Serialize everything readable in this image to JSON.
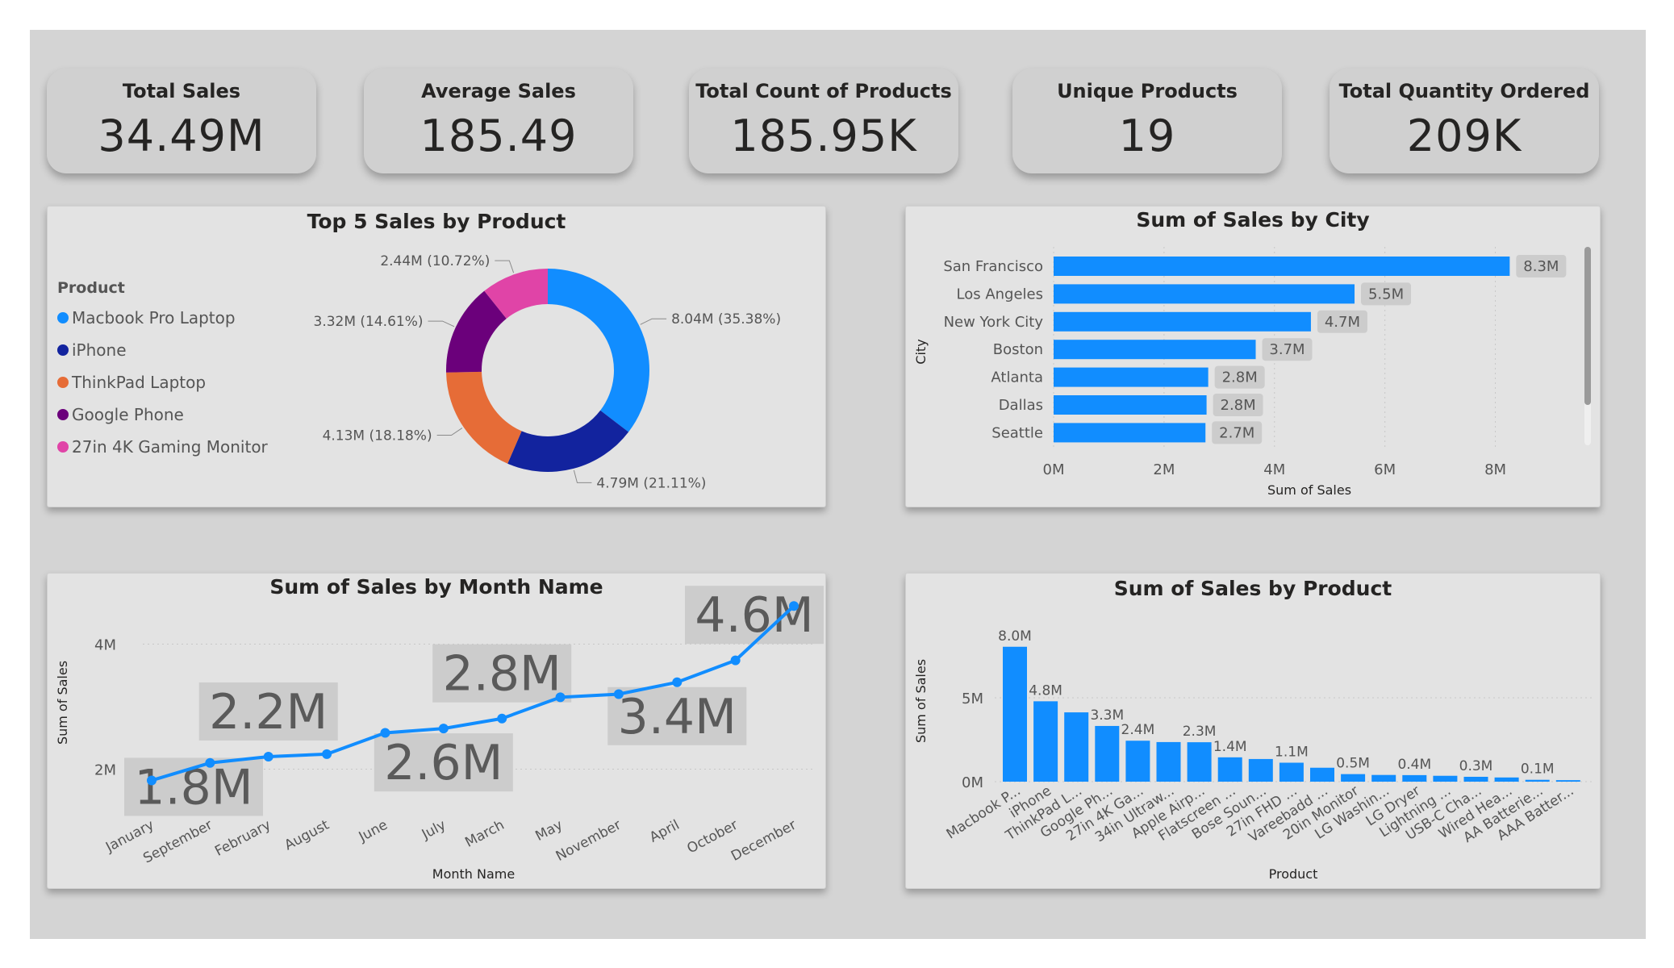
{
  "kpis": [
    {
      "title": "Total Sales",
      "value": "34.49M"
    },
    {
      "title": "Average Sales",
      "value": "185.49"
    },
    {
      "title": "Total Count of Products",
      "value": "185.95K"
    },
    {
      "title": "Unique Products",
      "value": "19"
    },
    {
      "title": "Total Quantity Ordered",
      "value": "209K"
    }
  ],
  "colors": {
    "bar": "#118DFF",
    "label_box": "#cccccc"
  },
  "chart_data": [
    {
      "type": "pie",
      "title": "Top 5 Sales by Product",
      "legend_title": "Product",
      "legend_position": "left",
      "donut": true,
      "slices": [
        {
          "name": "Macbook Pro Laptop",
          "value": 8.04,
          "label": "8.04M (35.38%)",
          "color": "#118DFF"
        },
        {
          "name": "iPhone",
          "value": 4.79,
          "label": "4.79M (21.11%)",
          "color": "#12239E"
        },
        {
          "name": "ThinkPad Laptop",
          "value": 4.13,
          "label": "4.13M (18.18%)",
          "color": "#E66C37"
        },
        {
          "name": "Google Phone",
          "value": 3.32,
          "label": "3.32M (14.61%)",
          "color": "#6B007B"
        },
        {
          "name": "27in 4K Gaming Monitor",
          "value": 2.44,
          "label": "2.44M (10.72%)",
          "color": "#E044A7"
        }
      ]
    },
    {
      "type": "bar",
      "orientation": "horizontal",
      "title": "Sum of Sales by City",
      "xlabel": "Sum of Sales",
      "ylabel": "City",
      "categories": [
        "San Francisco",
        "Los Angeles",
        "New York City",
        "Boston",
        "Atlanta",
        "Dallas",
        "Seattle"
      ],
      "values": [
        8.26,
        5.45,
        4.66,
        3.66,
        2.8,
        2.77,
        2.75
      ],
      "data_labels": [
        "8.3M",
        "5.5M",
        "4.7M",
        "3.7M",
        "2.8M",
        "2.8M",
        "2.7M"
      ],
      "xlim": [
        0,
        9
      ],
      "ticks": [
        0,
        2,
        4,
        6,
        8
      ],
      "tick_labels": [
        "0M",
        "2M",
        "4M",
        "6M",
        "8M"
      ],
      "grid": true
    },
    {
      "type": "line",
      "title": "Sum of Sales by Month Name",
      "xlabel": "Month Name",
      "ylabel": "Sum of Sales",
      "categories": [
        "January",
        "September",
        "February",
        "August",
        "June",
        "July",
        "March",
        "May",
        "November",
        "April",
        "October",
        "December"
      ],
      "values": [
        1.82,
        2.1,
        2.2,
        2.24,
        2.58,
        2.65,
        2.81,
        3.15,
        3.2,
        3.39,
        3.74,
        4.61
      ],
      "data_labels": [
        {
          "index": 0,
          "text": "1.8M"
        },
        {
          "index": 2,
          "text": "2.2M"
        },
        {
          "index": 5,
          "text": "2.6M"
        },
        {
          "index": 6,
          "text": "2.8M"
        },
        {
          "index": 9,
          "text": "3.4M"
        },
        {
          "index": 11,
          "text": "4.6M"
        }
      ],
      "ylim": [
        0.6,
        5.0
      ],
      "ticks": [
        2,
        4
      ],
      "tick_labels": [
        "2M",
        "4M"
      ],
      "grid": true
    },
    {
      "type": "bar",
      "orientation": "vertical",
      "title": "Sum of Sales by Product",
      "xlabel": "Product",
      "ylabel": "Sum of Sales",
      "categories": [
        "Macbook P...",
        "iPhone",
        "ThinkPad L...",
        "Google Ph...",
        "27in 4K Ga...",
        "34in Ultraw...",
        "Apple Airp...",
        "Flatscreen ...",
        "Bose Soun...",
        "27in FHD ...",
        "Vareebadd ...",
        "20in Monitor",
        "LG Washin...",
        "LG Dryer",
        "Lightning ...",
        "USB-C Cha...",
        "Wired Hea...",
        "AA Batterie...",
        "AAA Batter..."
      ],
      "values": [
        8.04,
        4.79,
        4.13,
        3.32,
        2.44,
        2.36,
        2.35,
        1.45,
        1.35,
        1.13,
        0.83,
        0.45,
        0.4,
        0.39,
        0.35,
        0.29,
        0.25,
        0.11,
        0.09
      ],
      "data_labels": [
        {
          "index": 0,
          "text": "8.0M"
        },
        {
          "index": 1,
          "text": "4.8M"
        },
        {
          "index": 3,
          "text": "3.3M"
        },
        {
          "index": 4,
          "text": "2.4M"
        },
        {
          "index": 6,
          "text": "2.3M"
        },
        {
          "index": 7,
          "text": "1.4M"
        },
        {
          "index": 9,
          "text": "1.1M"
        },
        {
          "index": 11,
          "text": "0.5M"
        },
        {
          "index": 13,
          "text": "0.4M"
        },
        {
          "index": 15,
          "text": "0.3M"
        },
        {
          "index": 17,
          "text": "0.1M"
        }
      ],
      "ylim": [
        0,
        9
      ],
      "ticks": [
        0,
        5
      ],
      "tick_labels": [
        "0M",
        "5M"
      ],
      "grid": true
    }
  ]
}
